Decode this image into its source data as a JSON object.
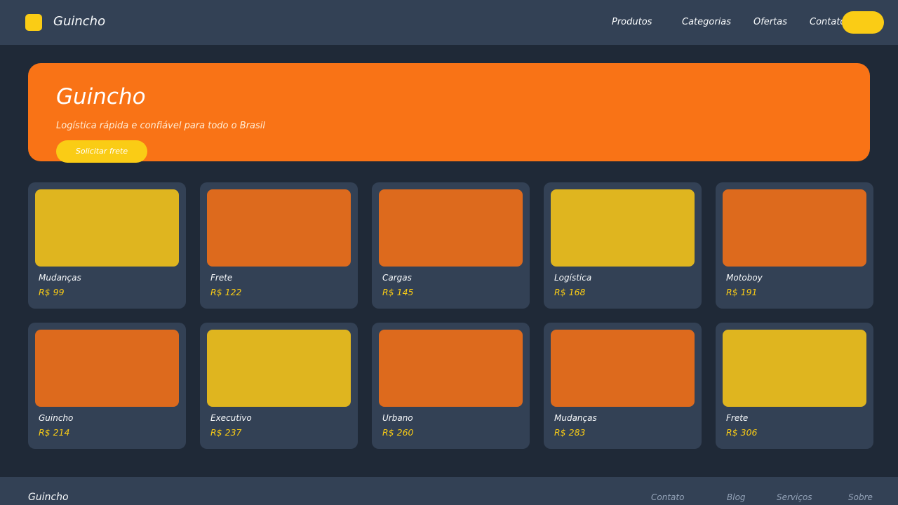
{
  "header": {
    "brand": "Guincho",
    "nav": [
      "Produtos",
      "Categorias",
      "Ofertas",
      "Contato"
    ]
  },
  "hero": {
    "title": "Guincho",
    "subtitle": "Logística rápida e confiável para todo o Brasil",
    "cta": "Solicitar frete"
  },
  "products": [
    {
      "name": "Mudanças",
      "price": "R$ 99",
      "color": "#dfb51f"
    },
    {
      "name": "Frete",
      "price": "R$ 122",
      "color": "#dd6a1d"
    },
    {
      "name": "Cargas",
      "price": "R$ 145",
      "color": "#dd6a1d"
    },
    {
      "name": "Logística",
      "price": "R$ 168",
      "color": "#dfb51f"
    },
    {
      "name": "Motoboy",
      "price": "R$ 191",
      "color": "#dd6a1d"
    },
    {
      "name": "Guincho",
      "price": "R$ 214",
      "color": "#dd6a1d"
    },
    {
      "name": "Executivo",
      "price": "R$ 237",
      "color": "#dfb51f"
    },
    {
      "name": "Urbano",
      "price": "R$ 260",
      "color": "#dd6a1d"
    },
    {
      "name": "Mudanças",
      "price": "R$ 283",
      "color": "#dd6a1d"
    },
    {
      "name": "Frete",
      "price": "R$ 306",
      "color": "#dfb51f"
    }
  ],
  "footer": {
    "brand": "Guincho",
    "links": [
      "Contato",
      "Blog",
      "Serviços",
      "Sobre"
    ]
  },
  "colors": {
    "background": "#1f2937",
    "surface": "#334155",
    "accent_orange": "#f97316",
    "accent_yellow": "#facc15"
  }
}
